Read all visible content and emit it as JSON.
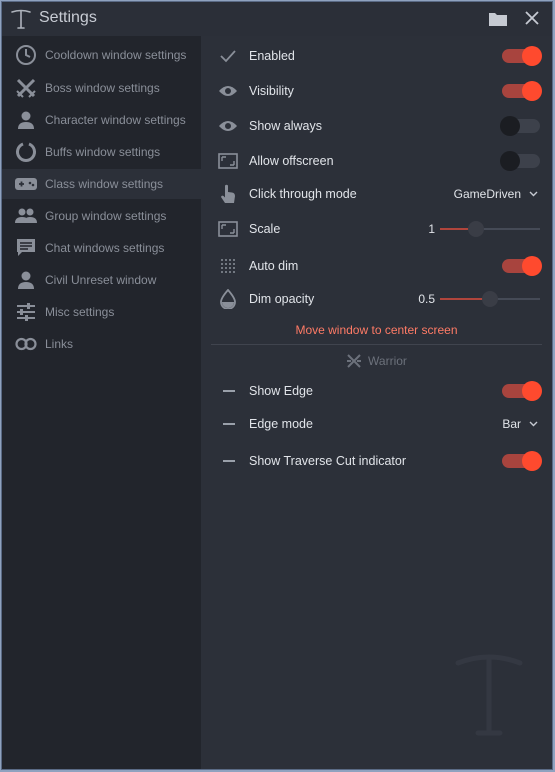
{
  "window": {
    "title": "Settings"
  },
  "sidebar": {
    "items": [
      {
        "label": "Cooldown window settings",
        "icon": "clock-icon"
      },
      {
        "label": "Boss window settings",
        "icon": "crossed-swords-icon"
      },
      {
        "label": "Character window settings",
        "icon": "person-icon"
      },
      {
        "label": "Buffs window settings",
        "icon": "circle-notch-icon"
      },
      {
        "label": "Class window settings",
        "icon": "gamepad-icon",
        "active": true
      },
      {
        "label": "Group window settings",
        "icon": "group-icon"
      },
      {
        "label": "Chat windows settings",
        "icon": "chat-icon"
      },
      {
        "label": "Civil Unreset window",
        "icon": "person-icon"
      },
      {
        "label": "Misc settings",
        "icon": "sliders-icon"
      },
      {
        "label": "Links",
        "icon": "link-icon"
      }
    ]
  },
  "settings": {
    "enabled": {
      "label": "Enabled",
      "on": true
    },
    "visibility": {
      "label": "Visibility",
      "on": true
    },
    "show_always": {
      "label": "Show always",
      "on": false
    },
    "allow_offscreen": {
      "label": "Allow offscreen",
      "on": false
    },
    "click_through": {
      "label": "Click through mode",
      "value": "GameDriven"
    },
    "scale": {
      "label": "Scale",
      "value": "1",
      "fraction": 0.36
    },
    "auto_dim": {
      "label": "Auto dim",
      "on": true
    },
    "dim_opacity": {
      "label": "Dim opacity",
      "value": "0.5",
      "fraction": 0.5
    },
    "move_link": "Move window to center screen"
  },
  "class_section": {
    "name": "Warrior",
    "show_edge": {
      "label": "Show Edge",
      "on": true
    },
    "edge_mode": {
      "label": "Edge mode",
      "value": "Bar"
    },
    "traverse_cut": {
      "label": "Show Traverse Cut indicator",
      "on": true
    }
  },
  "colors": {
    "accent": "#ff4a2e",
    "track_on": "#a8443e",
    "link": "#ff7b66",
    "background": "#272a32"
  }
}
